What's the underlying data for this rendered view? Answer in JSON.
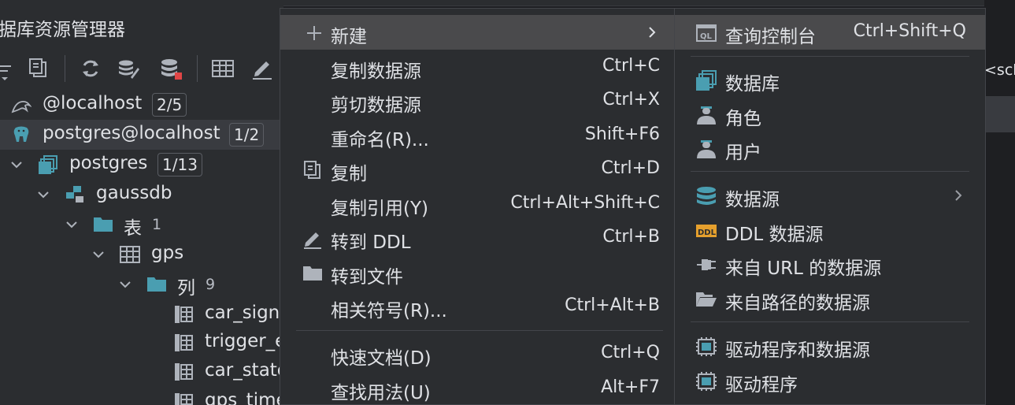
{
  "panel": {
    "title": "据库资源管理器",
    "toolbar": [
      "expand-icon",
      "copy-icon",
      "refresh-icon",
      "settings-icon",
      "datasource-icon",
      "table-icon",
      "edit-icon"
    ],
    "tree": [
      {
        "label": "@localhost",
        "badge": "2/5"
      },
      {
        "label": "postgres@localhost",
        "badge": "1/2"
      },
      {
        "label": "postgres",
        "badge": "1/13"
      },
      {
        "label": "gaussdb"
      },
      {
        "label": "表",
        "count": "1"
      },
      {
        "label": "gps"
      },
      {
        "label": "列",
        "count": "9"
      },
      {
        "label": "car_sign"
      },
      {
        "label": "trigger_e"
      },
      {
        "label": "car_state"
      },
      {
        "label": "gps_time"
      }
    ]
  },
  "editor": {
    "tab_fragment": "<sch"
  },
  "menu": {
    "items": [
      {
        "label": "新建",
        "shortcut": "",
        "submenu": true
      },
      {
        "label": "复制数据源",
        "shortcut": "Ctrl+C"
      },
      {
        "label": "剪切数据源",
        "shortcut": "Ctrl+X"
      },
      {
        "label": "重命名(R)...",
        "shortcut": "Shift+F6"
      },
      {
        "label": "复制",
        "shortcut": "Ctrl+D"
      },
      {
        "label": "复制引用(Y)",
        "shortcut": "Ctrl+Alt+Shift+C"
      },
      {
        "label": "转到 DDL",
        "shortcut": "Ctrl+B"
      },
      {
        "label": "转到文件",
        "shortcut": ""
      },
      {
        "label": "相关符号(R)...",
        "shortcut": "Ctrl+Alt+B"
      },
      {
        "label": "快速文档(D)",
        "shortcut": "Ctrl+Q"
      },
      {
        "label": "查找用法(U)",
        "shortcut": "Alt+F7"
      }
    ]
  },
  "submenu": {
    "items": [
      {
        "label": "查询控制台",
        "shortcut": "Ctrl+Shift+Q",
        "icon": "ql-console-icon"
      },
      {
        "label": "数据库",
        "icon": "database-icon"
      },
      {
        "label": "角色",
        "icon": "role-icon"
      },
      {
        "label": "用户",
        "icon": "user-icon"
      },
      {
        "label": "数据源",
        "icon": "datasource-icon",
        "submenu": true
      },
      {
        "label": "DDL 数据源",
        "icon": "ddl-icon"
      },
      {
        "label": "来自 URL 的数据源",
        "icon": "url-plug-icon"
      },
      {
        "label": "来自路径的数据源",
        "icon": "folder-open-icon"
      },
      {
        "label": "驱动程序和数据源",
        "icon": "driver-icon"
      },
      {
        "label": "驱动程序",
        "icon": "driver-icon"
      }
    ]
  },
  "colors": {
    "panel_bg": "#2b2d30",
    "selected_bg": "#4a4a4c",
    "accent_teal": "#4a9eb1",
    "icon_gray": "#aeb3bb",
    "ddl_orange": "#e6a02d",
    "alert_red": "#e04646"
  }
}
